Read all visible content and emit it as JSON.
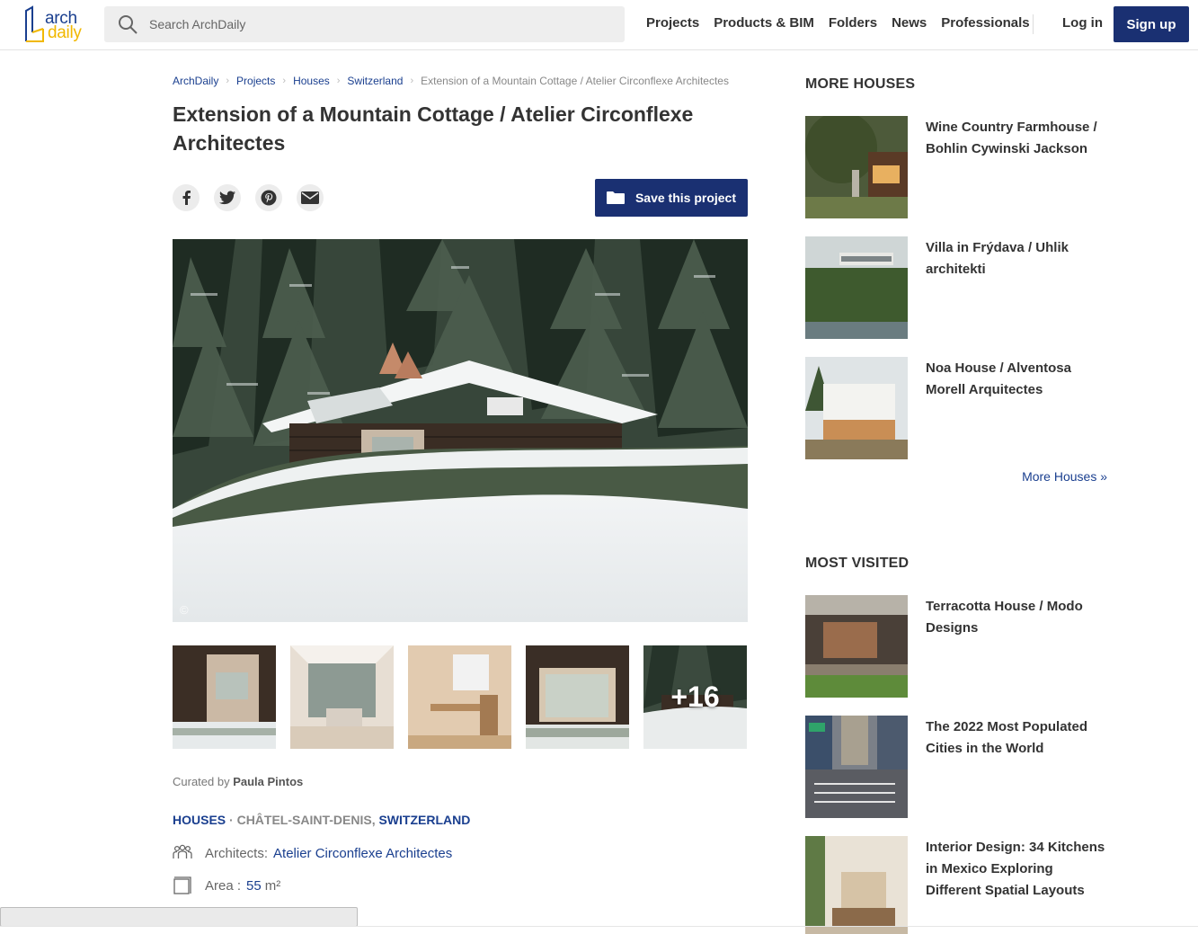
{
  "header": {
    "logo_word1": "arch",
    "logo_word2": "daily",
    "search_placeholder": "Search ArchDaily",
    "nav": [
      "Projects",
      "Products & BIM",
      "Folders",
      "News",
      "Professionals"
    ],
    "login": "Log in",
    "signup": "Sign up"
  },
  "breadcrumb": [
    "ArchDaily",
    "Projects",
    "Houses",
    "Switzerland"
  ],
  "breadcrumb_current": "Extension of a Mountain Cottage / Atelier Circonflexe Architectes",
  "title": "Extension of a Mountain Cottage / Atelier Circonflexe Architectes",
  "share_icons": [
    "facebook-icon",
    "twitter-icon",
    "pinterest-icon",
    "email-icon"
  ],
  "save_button": "Save this project",
  "main_image": {
    "copyright_symbol": "©"
  },
  "thumbnails": {
    "more_count": "+16"
  },
  "curated": {
    "prefix": "Curated by",
    "name": "Paula Pintos"
  },
  "meta": {
    "category": "HOUSES",
    "sep": "·",
    "city": "CHÂTEL-SAINT-DENIS,",
    "country": "SWITZERLAND"
  },
  "specs": {
    "architects_label": "Architects:",
    "architects_value": "Atelier Circonflexe Architectes",
    "area_label": "Area :",
    "area_value": "55",
    "area_unit": "m²"
  },
  "sidebar": {
    "more_houses_title": "MORE HOUSES",
    "more_houses": [
      "Wine Country Farmhouse / Bohlin Cywinski Jackson",
      "Villa in Frýdava / Uhlik architekti",
      "Noa House / Alventosa Morell Arquitectes"
    ],
    "more_houses_link": "More Houses »",
    "most_visited_title": "MOST VISITED",
    "most_visited": [
      "Terracotta House / Modo Designs",
      "The 2022 Most Populated Cities in the World",
      "Interior Design: 34 Kitchens in Mexico Exploring Different Spatial Layouts"
    ]
  },
  "colors": {
    "brand_blue": "#1a3072",
    "link_blue": "#1a3f8f",
    "logo_yellow": "#f1b800"
  }
}
